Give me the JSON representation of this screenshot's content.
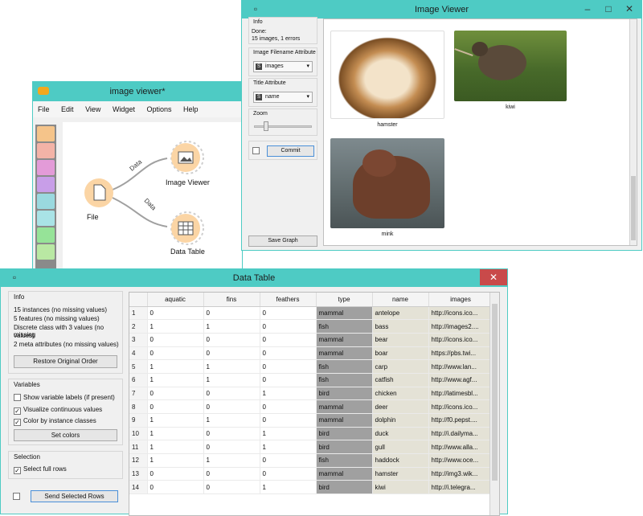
{
  "canvas_window": {
    "title": "image viewer*",
    "menu": [
      "File",
      "Edit",
      "View",
      "Widget",
      "Options",
      "Help"
    ],
    "nodes": {
      "file": "File",
      "image_viewer": "Image Viewer",
      "data_table": "Data Table"
    },
    "link_label": "Data"
  },
  "image_viewer_window": {
    "title": "Image Viewer",
    "info_title": "Info",
    "info_status": "Done:",
    "info_counts": "15 images, 1 errors",
    "filename_attr_title": "Image Filename Attribute",
    "filename_attr_value": "images",
    "title_attr_title": "Title Attribute",
    "title_attr_value": "name",
    "zoom_title": "Zoom",
    "zoom_level": 0.17,
    "commit_label": "Commit",
    "save_graph_label": "Save Graph",
    "images": [
      {
        "caption": "hamster",
        "color": "#b98448"
      },
      {
        "caption": "kiwi",
        "color": "#5a7a3a"
      },
      {
        "caption": "mink",
        "color": "#6b4a3a"
      }
    ]
  },
  "data_table_window": {
    "title": "Data Table",
    "info_title": "Info",
    "info_lines": [
      "15 instances (no missing values)",
      "5 features (no missing values)",
      "Discrete class with 3 values (no missing",
      "values)",
      "2 meta attributes (no missing values)"
    ],
    "restore_label": "Restore Original Order",
    "variables_title": "Variables",
    "variables_options": [
      {
        "label": "Show variable labels (if present)",
        "checked": false
      },
      {
        "label": "Visualize continuous values",
        "checked": true
      },
      {
        "label": "Color by instance classes",
        "checked": true
      }
    ],
    "set_colors_label": "Set colors",
    "selection_title": "Selection",
    "select_full_rows_label": "Select full rows",
    "send_rows_label": "Send Selected Rows",
    "columns": [
      "aquatic",
      "fins",
      "feathers",
      "type",
      "name",
      "images"
    ],
    "rows": [
      [
        "1",
        "0",
        "0",
        "0",
        "mammal",
        "antelope",
        "http://icons.ico..."
      ],
      [
        "2",
        "1",
        "1",
        "0",
        "fish",
        "bass",
        "http://images2...."
      ],
      [
        "3",
        "0",
        "0",
        "0",
        "mammal",
        "bear",
        "http://icons.ico..."
      ],
      [
        "4",
        "0",
        "0",
        "0",
        "mammal",
        "boar",
        "https://pbs.twi..."
      ],
      [
        "5",
        "1",
        "1",
        "0",
        "fish",
        "carp",
        "http://www.lan..."
      ],
      [
        "6",
        "1",
        "1",
        "0",
        "fish",
        "catfish",
        "http://www.agf..."
      ],
      [
        "7",
        "0",
        "0",
        "1",
        "bird",
        "chicken",
        "http://latimesbl..."
      ],
      [
        "8",
        "0",
        "0",
        "0",
        "mammal",
        "deer",
        "http://icons.ico..."
      ],
      [
        "9",
        "1",
        "1",
        "0",
        "mammal",
        "dolphin",
        "http://f0.pepst...."
      ],
      [
        "10",
        "1",
        "0",
        "1",
        "bird",
        "duck",
        "http://i.dailyma..."
      ],
      [
        "11",
        "1",
        "0",
        "1",
        "bird",
        "gull",
        "http://www.alla..."
      ],
      [
        "12",
        "1",
        "1",
        "0",
        "fish",
        "haddock",
        "http://www.oce..."
      ],
      [
        "13",
        "0",
        "0",
        "0",
        "mammal",
        "hamster",
        "http://img3.wik..."
      ],
      [
        "14",
        "0",
        "0",
        "1",
        "bird",
        "kiwi",
        "http://i.telegra..."
      ]
    ]
  },
  "colors": {
    "titlebar": "#4ecbc4",
    "widget_orange": "#fbd5a5",
    "class_cell": "#a0a0a0",
    "meta_cell": "#e4e2d6",
    "close_button": "#c94a4a"
  }
}
